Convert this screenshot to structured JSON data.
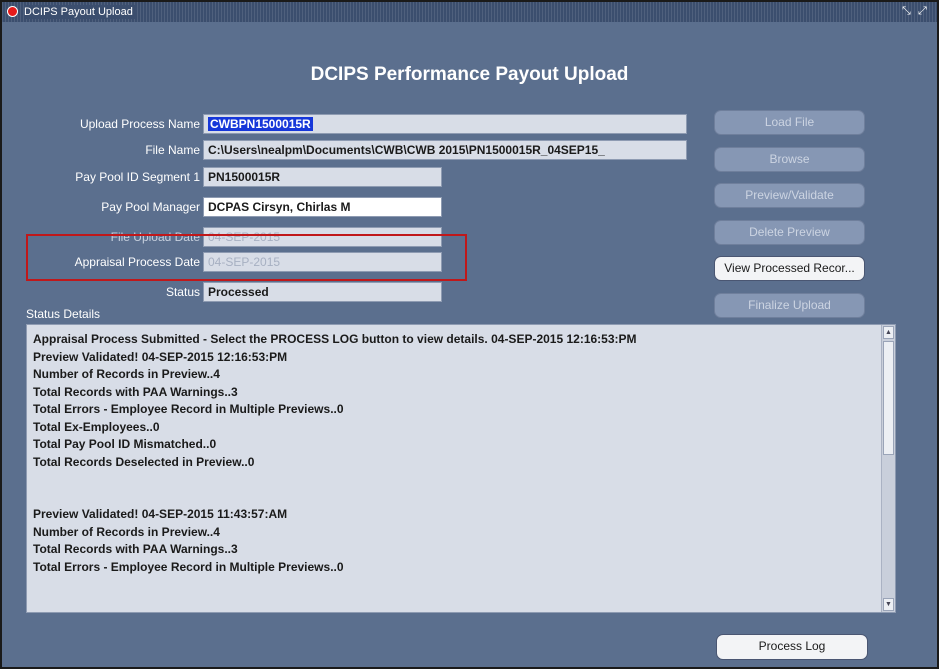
{
  "window": {
    "title": "DCIPS Payout Upload",
    "controls": [
      "⤡",
      "⤢"
    ]
  },
  "form": {
    "heading": "DCIPS Performance Payout Upload",
    "fields": [
      {
        "label": "Upload Process Name",
        "value": "CWBPN1500015R"
      },
      {
        "label": "File Name",
        "value": "C:\\Users\\nealpm\\Documents\\CWB\\CWB 2015\\PN1500015R_04SEP15_"
      },
      {
        "label": "Pay Pool ID Segment 1",
        "value": "PN1500015R"
      },
      {
        "label": "Pay Pool Manager",
        "value": "DCPAS Cirsyn, Chirlas M"
      },
      {
        "label": "File Upload Date",
        "value": "04-SEP-2015"
      },
      {
        "label": "Appraisal Process Date",
        "value": "04-SEP-2015"
      },
      {
        "label": "Status",
        "value": "Processed"
      }
    ]
  },
  "buttons": {
    "load_file": "Load File",
    "browse": "Browse",
    "preview_validate": "Preview/Validate",
    "delete_preview": "Delete Preview",
    "view_processed": "View Processed Recor...",
    "finalize_upload": "Finalize Upload",
    "process_log": "Process Log"
  },
  "status": {
    "title": "Status Details",
    "lines": [
      "Appraisal Process Submitted - Select the PROCESS LOG button to view details.  04-SEP-2015 12:16:53:PM",
      "Preview Validated! 04-SEP-2015 12:16:53:PM",
      "Number of Records in Preview..4",
      "Total Records with PAA Warnings..3",
      "Total Errors - Employee Record in Multiple Previews..0",
      "Total Ex-Employees..0",
      "Total Pay Pool ID Mismatched..0",
      "Total Records Deselected in Preview..0",
      "",
      "",
      "Preview Validated! 04-SEP-2015 11:43:57:AM",
      "Number of Records in Preview..4",
      "Total Records with PAA Warnings..3",
      "Total Errors - Employee Record in Multiple Previews..0"
    ]
  }
}
